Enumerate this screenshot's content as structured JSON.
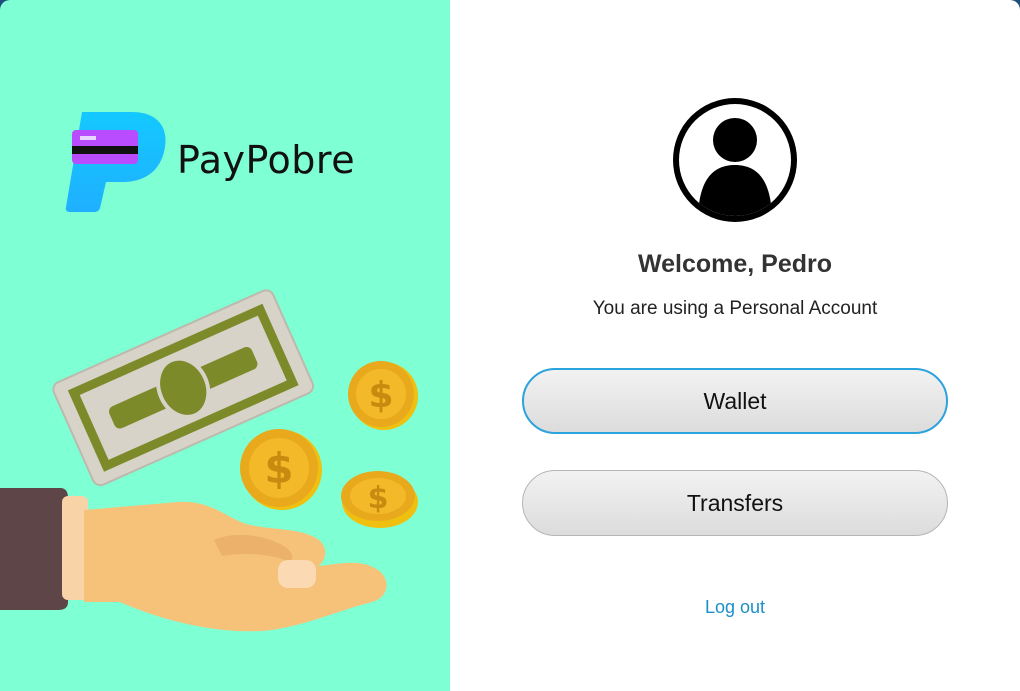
{
  "brand": {
    "name": "PayPobre"
  },
  "user": {
    "welcome": "Welcome, Pedro",
    "account_type": "You are using a Personal Account"
  },
  "actions": {
    "wallet_label": "Wallet",
    "transfers_label": "Transfers",
    "logout_label": "Log out"
  },
  "icons": {
    "logo": "paypobre-logo-icon",
    "avatar": "user-avatar-icon",
    "illustration": "hand-money-illustration"
  },
  "colors": {
    "left_bg": "#7fffd4",
    "accent": "#2ba3dc",
    "link": "#1a8fc9"
  }
}
